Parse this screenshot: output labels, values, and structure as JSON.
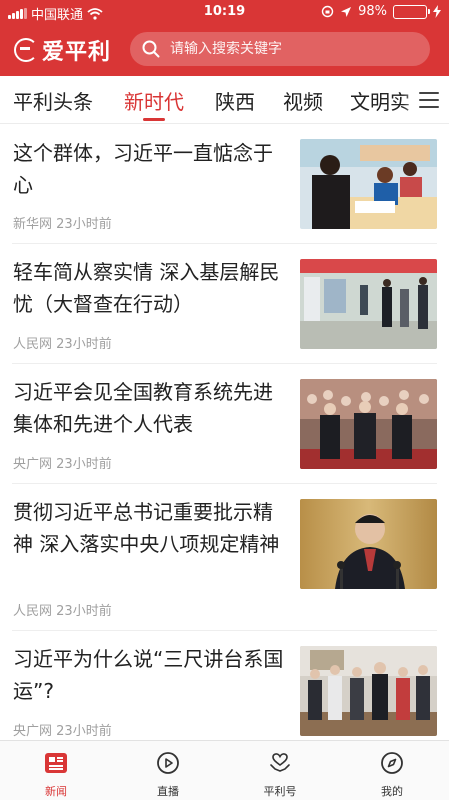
{
  "status_bar": {
    "carrier": "中国联通",
    "time": "10:19",
    "battery": "98%",
    "battery_level": 0.98,
    "colors": {
      "battery_fill": "#5fd35f"
    }
  },
  "app": {
    "logo_text": "爱平利",
    "search_placeholder": "请输入搜索关键字",
    "accent_color": "#d93636"
  },
  "tabs": [
    {
      "label": "平利头条",
      "active": false
    },
    {
      "label": "新时代",
      "active": true
    },
    {
      "label": "陕西",
      "active": false
    },
    {
      "label": "视频",
      "active": false
    },
    {
      "label": "文明实",
      "active": false
    }
  ],
  "news": [
    {
      "title": "这个群体，习近平一直惦念于心",
      "source": "新华网",
      "time": "23小时前",
      "thumb_icon": "classroom-photo"
    },
    {
      "title": "轻车简从察实情 深入基层解民忧（大督查在行动）",
      "source": "人民网",
      "time": "23小时前",
      "thumb_icon": "inspection-photo"
    },
    {
      "title": "习近平会见全国教育系统先进集体和先进个人代表",
      "source": "央广网",
      "time": "23小时前",
      "thumb_icon": "meeting-crowd-photo"
    },
    {
      "title": "贯彻习近平总书记重要批示精神 深入落实中央八项规定精神",
      "source": "人民网",
      "time": "23小时前",
      "thumb_icon": "speaker-photo"
    },
    {
      "title": "习近平为什么说“三尺讲台系国运”?",
      "source": "央广网",
      "time": "23小时前",
      "thumb_icon": "school-visit-photo"
    }
  ],
  "bottom_nav": [
    {
      "label": "新闻",
      "icon": "newspaper-icon",
      "active": true
    },
    {
      "label": "直播",
      "icon": "play-icon",
      "active": false
    },
    {
      "label": "平利号",
      "icon": "heart-hand-icon",
      "active": false
    },
    {
      "label": "我的",
      "icon": "compass-icon",
      "active": false
    }
  ]
}
